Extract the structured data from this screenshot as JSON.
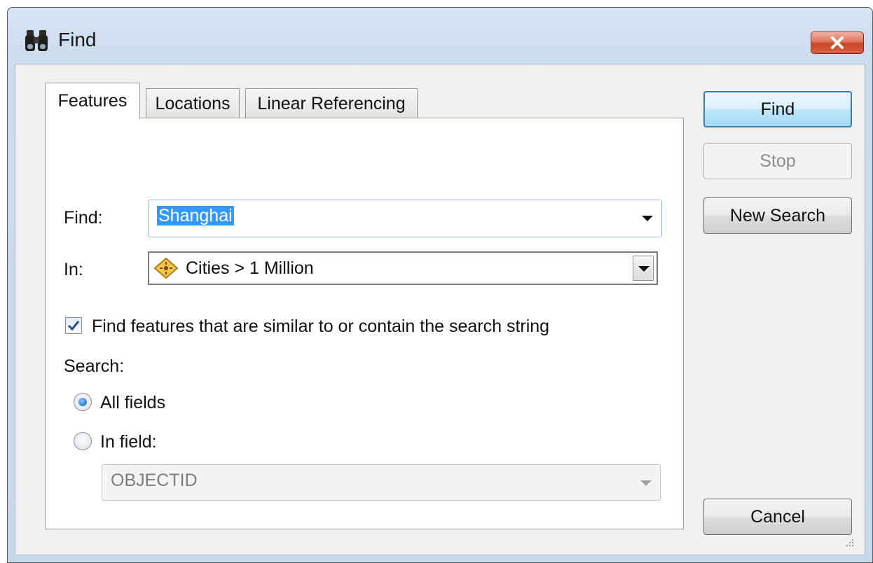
{
  "window": {
    "title": "Find"
  },
  "tabs": [
    {
      "label": "Features",
      "active": true
    },
    {
      "label": "Locations",
      "active": false
    },
    {
      "label": "Linear Referencing",
      "active": false
    }
  ],
  "form": {
    "find_label": "Find:",
    "find_value": "Shanghai",
    "in_label": "In:",
    "in_value": "Cities > 1 Million",
    "similar_checkbox": {
      "label": "Find features that are similar to or contain the search string",
      "checked": true
    },
    "search_label": "Search:",
    "radio_all": {
      "label": "All fields",
      "checked": true
    },
    "radio_field": {
      "label": "In field:",
      "checked": false
    },
    "field_select_value": "OBJECTID"
  },
  "buttons": {
    "find": "Find",
    "stop": "Stop",
    "new_search": "New Search",
    "cancel": "Cancel"
  },
  "icons": {
    "title": "binoculars-icon",
    "layer": "point-layer-icon",
    "close": "close-icon"
  },
  "colors": {
    "selection": "#3399ff",
    "close_button": "#c84628",
    "default_button_border": "#3c7fb1"
  }
}
